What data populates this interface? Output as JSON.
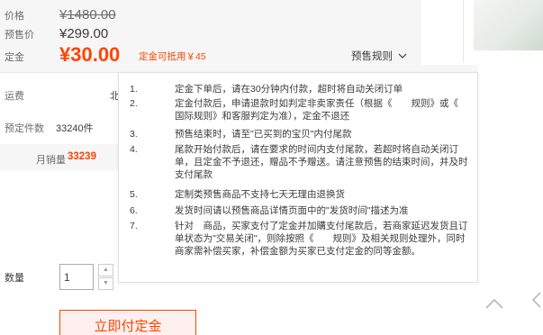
{
  "price": {
    "label": "价格",
    "original": "¥1480.00"
  },
  "presale": {
    "label": "预售价",
    "value": "¥299.00"
  },
  "deposit": {
    "label": "定金",
    "value": "¥30.00",
    "offset_text": "定金可抵用￥45",
    "rules_link": "预售规则",
    "rules_chevron": "chevron-down-icon"
  },
  "shipping": {
    "label": "运费",
    "value": "北"
  },
  "reserved": {
    "label": "预定件数",
    "value": "33240件"
  },
  "monthly": {
    "label": "月销量",
    "value": "33239"
  },
  "quantity": {
    "label": "数量",
    "value": "1"
  },
  "buy_button": "立即付定金",
  "rules": [
    {
      "num": "1.",
      "text": "定金下单后，请在30分钟内付款，超时将自动关闭订单"
    },
    {
      "num": "2.",
      "text": "定金付款后，申请退款时如判定非卖家责任（根据《　　规则》或《　　国际规则》和客服判定为准），定金不退还"
    },
    {
      "num": "3.",
      "text": "预售结束时，请至\"已买到的宝贝\"内付尾款"
    },
    {
      "num": "4.",
      "text": "尾款开始付款后，请在要求的时间内支付尾款，若超时将自动关闭订单，且定金不予退还，赠品不予赠送。请注意预售的结束时间，并及时支付尾款"
    },
    {
      "num": "5.",
      "text": "定制类预售商品不支持七天无理由退换货"
    },
    {
      "num": "6.",
      "text": "发货时间请以预售商品详情页面中的\"发货时间\"描述为准"
    },
    {
      "num": "7.",
      "text": "针对　商品，买家支付了定金并加購支付尾款后，若商家延迟发货且订单状态为\"交易关闭\"，则除按照《　　规则》及相关规则处理外，同时商家需补偿买家，补偿金额为买家已支付定金的同等金额。"
    }
  ],
  "colors": {
    "accent": "#ff4400",
    "button_bg": "#fef0ef"
  }
}
